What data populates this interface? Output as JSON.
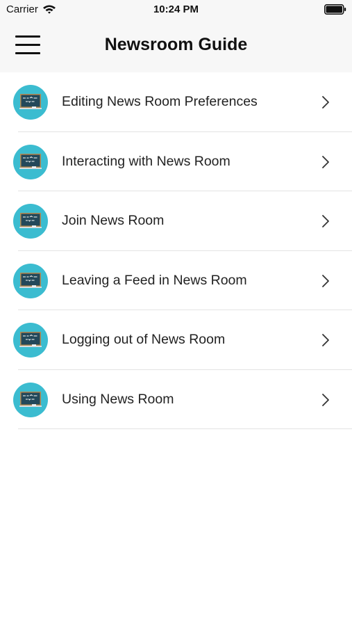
{
  "status_bar": {
    "carrier": "Carrier",
    "time": "10:24 PM",
    "icons": [
      "wifi-icon",
      "battery-icon"
    ]
  },
  "nav_bar": {
    "title": "Newsroom Guide",
    "menu_icon": "hamburger-menu-icon"
  },
  "list": {
    "item_icon": "chalkboard-icon",
    "trailing_icon": "chevron-right-icon",
    "items": [
      {
        "label": "Editing News Room Preferences"
      },
      {
        "label": "Interacting with News Room"
      },
      {
        "label": "Join News Room"
      },
      {
        "label": "Leaving a Feed in News Room"
      },
      {
        "label": "Logging out of News Room"
      },
      {
        "label": "Using News Room"
      }
    ]
  },
  "colors": {
    "icon_circle": "#3bbcd0",
    "board": "#23485a",
    "bar_background": "#f7f7f7",
    "separator": "#e3e3e3"
  }
}
